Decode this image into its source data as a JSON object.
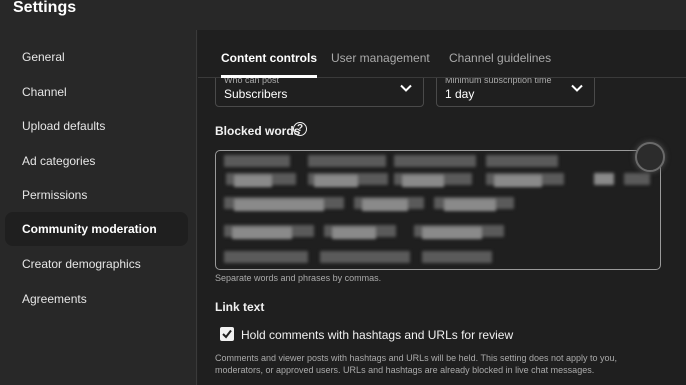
{
  "window": {
    "title": "Settings"
  },
  "sidebar": {
    "items": [
      {
        "label": "General",
        "active": false
      },
      {
        "label": "Channel",
        "active": false
      },
      {
        "label": "Upload defaults",
        "active": false
      },
      {
        "label": "Ad categories",
        "active": false
      },
      {
        "label": "Permissions",
        "active": false
      },
      {
        "label": "Community moderation",
        "active": true
      },
      {
        "label": "Creator demographics",
        "active": false
      },
      {
        "label": "Agreements",
        "active": false
      }
    ]
  },
  "tabs": [
    {
      "label": "Content controls",
      "active": true
    },
    {
      "label": "User management",
      "active": false
    },
    {
      "label": "Channel guidelines",
      "active": false
    }
  ],
  "who_can_post": {
    "label": "Who can post",
    "value": "Subscribers"
  },
  "min_subscription": {
    "label": "Minimum subscription time",
    "value": "1 day"
  },
  "blocked_words": {
    "label": "Blocked words",
    "help_icon": "help-circle-icon",
    "hint": "Separate words and phrases by commas."
  },
  "link_text": {
    "label": "Link text",
    "checkbox_label": "Hold comments with hashtags and URLs for review",
    "checked": true,
    "description_line1": "Comments and viewer posts with hashtags and URLs will be held. This setting does not apply to you,",
    "description_line2": "moderators, or approved users. URLs and hashtags are already blocked in live chat messages."
  }
}
